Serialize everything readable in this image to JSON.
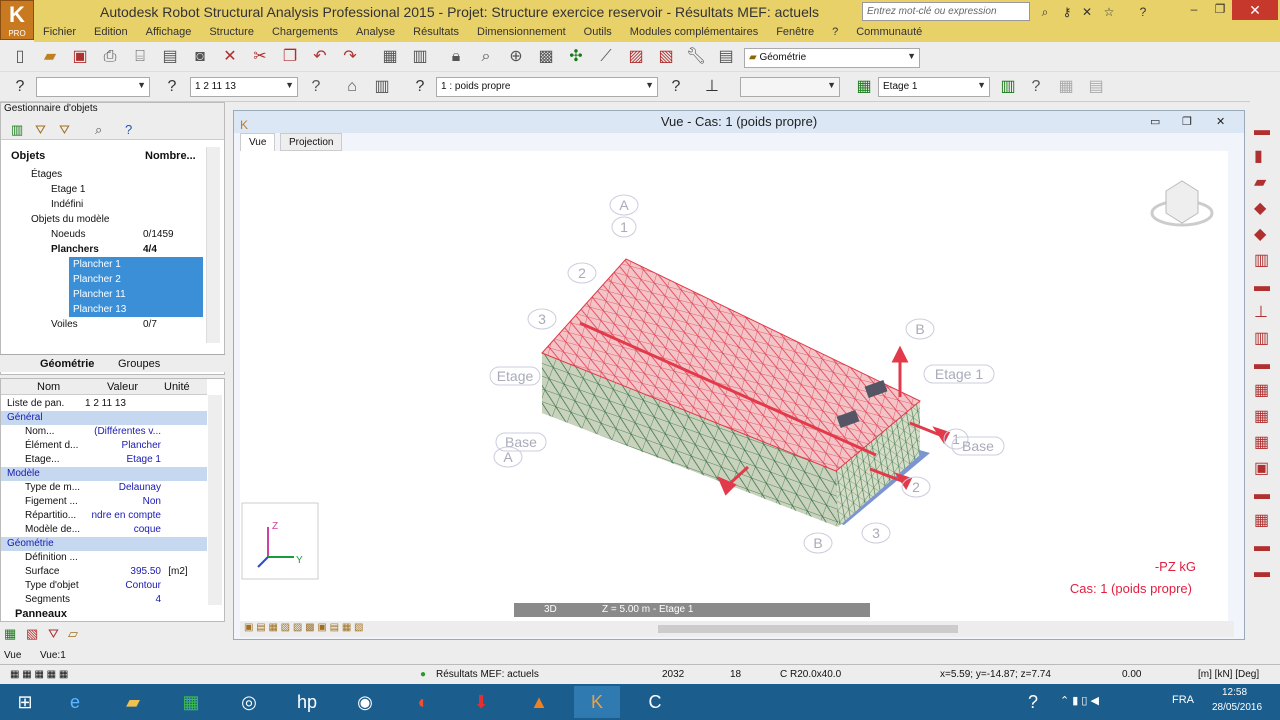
{
  "app": {
    "title": "Autodesk Robot Structural Analysis Professional 2015 - Projet: Structure exercice reservoir - Résultats MEF: actuels",
    "logo_label": "PRO",
    "search_placeholder": "Entrez mot-clé ou expression"
  },
  "menu": [
    "Fichier",
    "Edition",
    "Affichage",
    "Structure",
    "Chargements",
    "Analyse",
    "Résultats",
    "Dimensionnement",
    "Outils",
    "Modules complémentaires",
    "Fenêtre",
    "?",
    "Communauté"
  ],
  "toolbar1": {
    "geometry_select": "Géométrie"
  },
  "toolbar2": {
    "sel1": "",
    "sel2": "1 2 11 13",
    "load_case": "1 : poids propre",
    "story": "Etage 1"
  },
  "objects": {
    "header": "Gestionnaire d'objets",
    "col_objects": "Objets",
    "col_count": "Nombre...",
    "tree": [
      {
        "label": "Étages",
        "indent": 1
      },
      {
        "label": "Etage 1",
        "indent": 2
      },
      {
        "label": "Indéfini",
        "indent": 2
      },
      {
        "label": "Objets du modèle",
        "indent": 1
      },
      {
        "label": "Noeuds",
        "count": "0/1459",
        "indent": 2
      },
      {
        "label": "Planchers",
        "count": "4/4",
        "indent": 2,
        "bold": true
      },
      {
        "label": "Plancher     1",
        "indent": 3,
        "selected": true
      },
      {
        "label": "Plancher     2",
        "indent": 3,
        "selected": true
      },
      {
        "label": "Plancher     11",
        "indent": 3,
        "selected": true
      },
      {
        "label": "Plancher     13",
        "indent": 3,
        "selected": true
      },
      {
        "label": "Voiles",
        "count": "0/7",
        "indent": 2
      }
    ],
    "tabs": [
      "Géométrie",
      "Groupes"
    ]
  },
  "props": {
    "headers": [
      "Nom",
      "Valeur",
      "Unité"
    ],
    "rows": [
      {
        "name": "Liste de pan...",
        "value": "1 2 11 13",
        "unit": "",
        "type": "plain"
      },
      {
        "name": "Général",
        "type": "section"
      },
      {
        "name": "Nom...",
        "value": "(Différentes v...",
        "unit": ""
      },
      {
        "name": "Élément d...",
        "value": "Plancher",
        "unit": ""
      },
      {
        "name": "Etage...",
        "value": "Etage 1",
        "unit": ""
      },
      {
        "name": "Modèle",
        "type": "section"
      },
      {
        "name": "Type de m...",
        "value": "Delaunay",
        "unit": ""
      },
      {
        "name": "Figement ...",
        "value": "Non",
        "unit": ""
      },
      {
        "name": "Répartitio...",
        "value": "ndre en compte",
        "unit": ""
      },
      {
        "name": "Modèle de...",
        "value": "coque",
        "unit": ""
      },
      {
        "name": "Géométrie",
        "type": "section"
      },
      {
        "name": "Définition ...",
        "value": "",
        "unit": ""
      },
      {
        "name": "Surface",
        "value": "395.50",
        "unit": "[m2]"
      },
      {
        "name": "Type d'objet",
        "value": "Contour",
        "unit": ""
      },
      {
        "name": "Segments",
        "value": "4",
        "unit": ""
      }
    ],
    "panels_tab": "Panneaux"
  },
  "view": {
    "title": "Vue - Cas: 1 (poids propre)",
    "tabs": [
      "Vue",
      "Projection"
    ],
    "grid_labels": {
      "a_top": "A",
      "one_top": "1",
      "two": "2",
      "three": "3",
      "b_right": "B",
      "etage_left": "Etage",
      "etage_right": "Etage 1",
      "base_left": "Base",
      "a_bottom": "A",
      "one_right": "1",
      "base_right": "Base",
      "two_right": "2",
      "three_bottom": "3",
      "b_bottom": "B"
    },
    "legend_units": "-PZ  kG",
    "legend_case": "Cas: 1 (poids propre)",
    "bottom_3d": "3D",
    "bottom_z": "Z = 5.00 m - Etage 1",
    "axes": {
      "z": "Z",
      "y": "Y"
    }
  },
  "viewbar": {
    "left": "Vue",
    "right": "Vue:1"
  },
  "status": {
    "results": "Résultats MEF: actuels",
    "nodes": "2032",
    "count": "18",
    "section": "C R20.0x40.0",
    "coords": "x=5.59; y=-14.87; z=7.74",
    "value": "0.00",
    "units": "[m] [kN] [Deg]"
  },
  "tray": {
    "lang": "FRA",
    "time": "12:58",
    "date": "28/05/2016"
  },
  "colors": {
    "title": "#e9d16a",
    "select": "#3b8fd6",
    "mesh_red": "#e23a4a",
    "mesh_green": "#2b6a3b"
  }
}
